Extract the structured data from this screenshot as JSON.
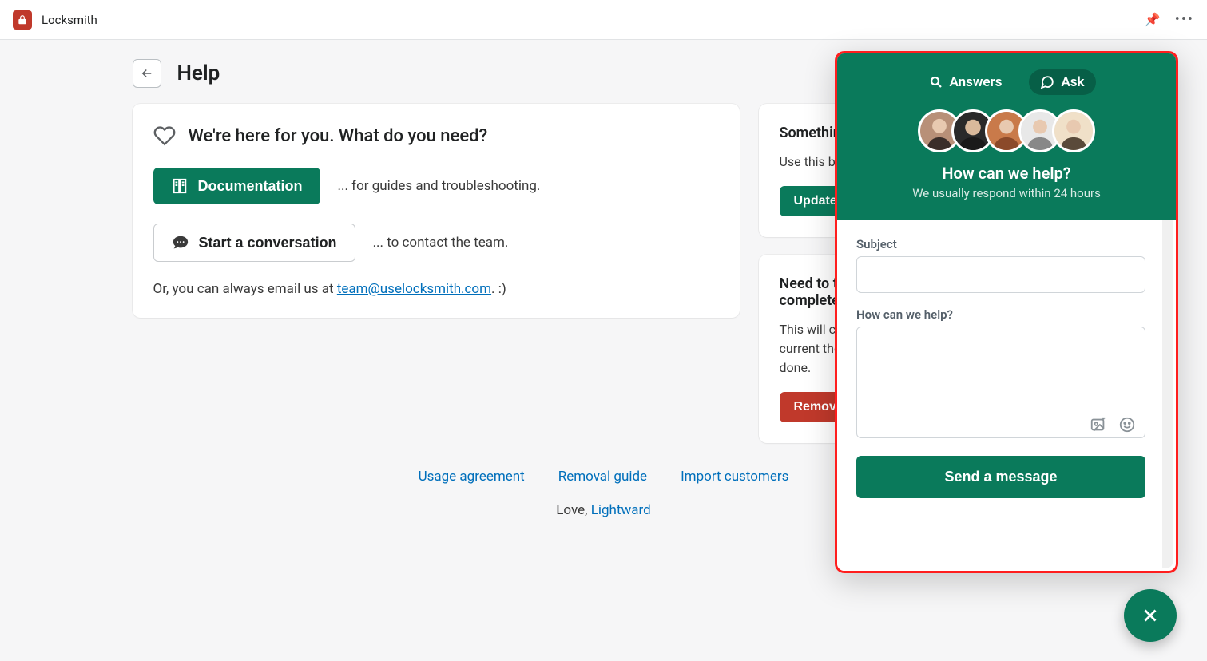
{
  "topbar": {
    "title": "Locksmith"
  },
  "page": {
    "title": "Help"
  },
  "main": {
    "hero": "We're here for you. What do you need?",
    "doc_btn": "Documentation",
    "doc_desc": "... for guides and troubleshooting.",
    "convo_btn": "Start a conversation",
    "convo_desc": "... to contact the team.",
    "email_prefix": "Or, you can always email us at ",
    "email": "team@uselocksmith.com",
    "email_suffix": ". :)"
  },
  "side": {
    "card1_title": "Something off?",
    "card1_text": "Use this button to refresh Locksmith's data.",
    "card1_btn": "Update",
    "card2_title": "Need to temporarily disable Locksmith completely?",
    "card2_text": "This will clear Locksmith's code from your current theme. Locksmith won't work until this is done.",
    "card2_btn": "Remove"
  },
  "footer": {
    "links": [
      "Usage agreement",
      "Removal guide",
      "Import customers"
    ],
    "love_prefix": "Love, ",
    "love_link": "Lightward"
  },
  "chat": {
    "tab_answers": "Answers",
    "tab_ask": "Ask",
    "title": "How can we help?",
    "sub": "We usually respond within 24 hours",
    "subject_label": "Subject",
    "body_label": "How can we help?",
    "send": "Send a message"
  }
}
